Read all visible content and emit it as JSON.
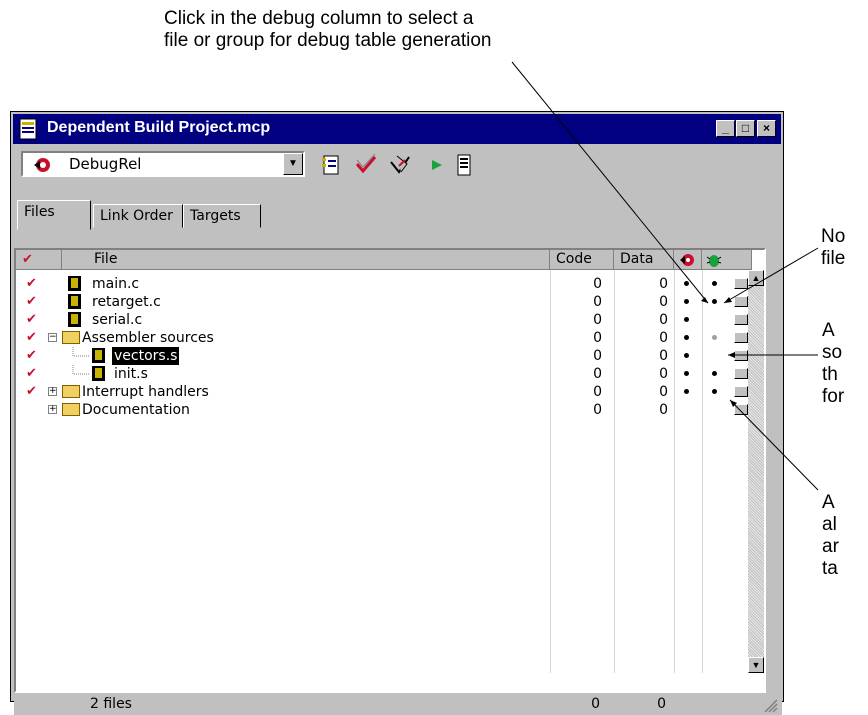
{
  "annotations": {
    "top": "Click in the debug column to select a\nfile or group for debug table generation",
    "right1": "No\nfile",
    "right2": "A\nso\nth\nfor",
    "right3": "A\nal\nar\nta"
  },
  "window": {
    "title": "Dependent Build Project.mcp",
    "target_combo": "DebugRel",
    "tabs": [
      "Files",
      "Link Order",
      "Targets"
    ],
    "columns": {
      "file": "File",
      "code": "Code",
      "data": "Data"
    },
    "rows": [
      {
        "name": "main.c",
        "code": "0",
        "data": "0"
      },
      {
        "name": "retarget.c",
        "code": "0",
        "data": "0"
      },
      {
        "name": "serial.c",
        "code": "0",
        "data": "0"
      },
      {
        "name": "Assembler sources",
        "code": "0",
        "data": "0"
      },
      {
        "name": "vectors.s",
        "code": "0",
        "data": "0"
      },
      {
        "name": "init.s",
        "code": "0",
        "data": "0"
      },
      {
        "name": "Interrupt handlers",
        "code": "0",
        "data": "0"
      },
      {
        "name": "Documentation",
        "code": "0",
        "data": "0"
      }
    ],
    "status": {
      "files": "2 files",
      "code_total": "0",
      "data_total": "0"
    }
  },
  "colors": {
    "titlebar": "#000080",
    "chrome": "#c0c0c0",
    "check": "#c8102e"
  }
}
